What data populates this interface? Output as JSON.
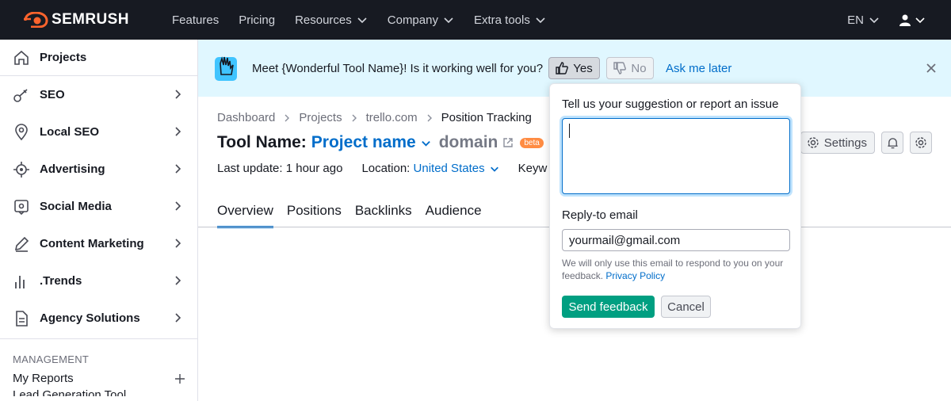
{
  "brand": {
    "name": "SEMRUSH",
    "accent": "#FF642D"
  },
  "nav": {
    "items": [
      {
        "label": "Features",
        "has_dropdown": false
      },
      {
        "label": "Pricing",
        "has_dropdown": false
      },
      {
        "label": "Resources",
        "has_dropdown": true
      },
      {
        "label": "Company",
        "has_dropdown": true
      },
      {
        "label": "Extra tools",
        "has_dropdown": true
      }
    ],
    "language": "EN"
  },
  "sidebar": {
    "projects_label": "Projects",
    "items": [
      {
        "label": "SEO",
        "icon": "seo-icon"
      },
      {
        "label": "Local SEO",
        "icon": "location-pin-icon"
      },
      {
        "label": "Advertising",
        "icon": "target-icon"
      },
      {
        "label": "Social Media",
        "icon": "social-media-icon"
      },
      {
        "label": "Content Marketing",
        "icon": "pen-icon"
      },
      {
        "label": ".Trends",
        "icon": "bar-chart-icon"
      },
      {
        "label": "Agency Solutions",
        "icon": "document-icon"
      }
    ],
    "management_label": "MANAGEMENT",
    "my_reports_label": "My Reports",
    "next_label": "Lead Generation Tool"
  },
  "banner": {
    "text": "Meet {Wonderful Tool Name}! Is it working well for you?",
    "yes_label": "Yes",
    "no_label": "No",
    "ask_later_label": "Ask me later",
    "background": "#E0F7FF"
  },
  "breadcrumb": [
    "Dashboard",
    "Projects",
    "trello.com",
    "Position Tracking"
  ],
  "title": {
    "prefix": "Tool Name:",
    "project": "Project name",
    "domain": "domain",
    "badge": "beta"
  },
  "meta": {
    "last_update": "Last update: 1 hour ago",
    "location_label": "Location:",
    "location_value": "United States",
    "keywords_label": "Keyw"
  },
  "tabs": [
    {
      "label": "Overview",
      "active": true
    },
    {
      "label": "Positions",
      "active": false
    },
    {
      "label": "Backlinks",
      "active": false
    },
    {
      "label": "Audience",
      "active": false
    }
  ],
  "toolbar": {
    "settings_label": "Settings"
  },
  "feedback": {
    "suggestion_label": "Tell us your suggestion or report an issue",
    "suggestion_value": "",
    "email_label": "Reply-to email",
    "email_value": "yourmail@gmail.com",
    "note": "We will only use this email to respond to you on your feedback.",
    "privacy_link": "Privacy Policy",
    "send_label": "Send feedback",
    "cancel_label": "Cancel"
  },
  "colors": {
    "link": "#006DCA",
    "primary_green": "#009F81",
    "beta": "#FF8C43",
    "topbar": "#171A22"
  }
}
